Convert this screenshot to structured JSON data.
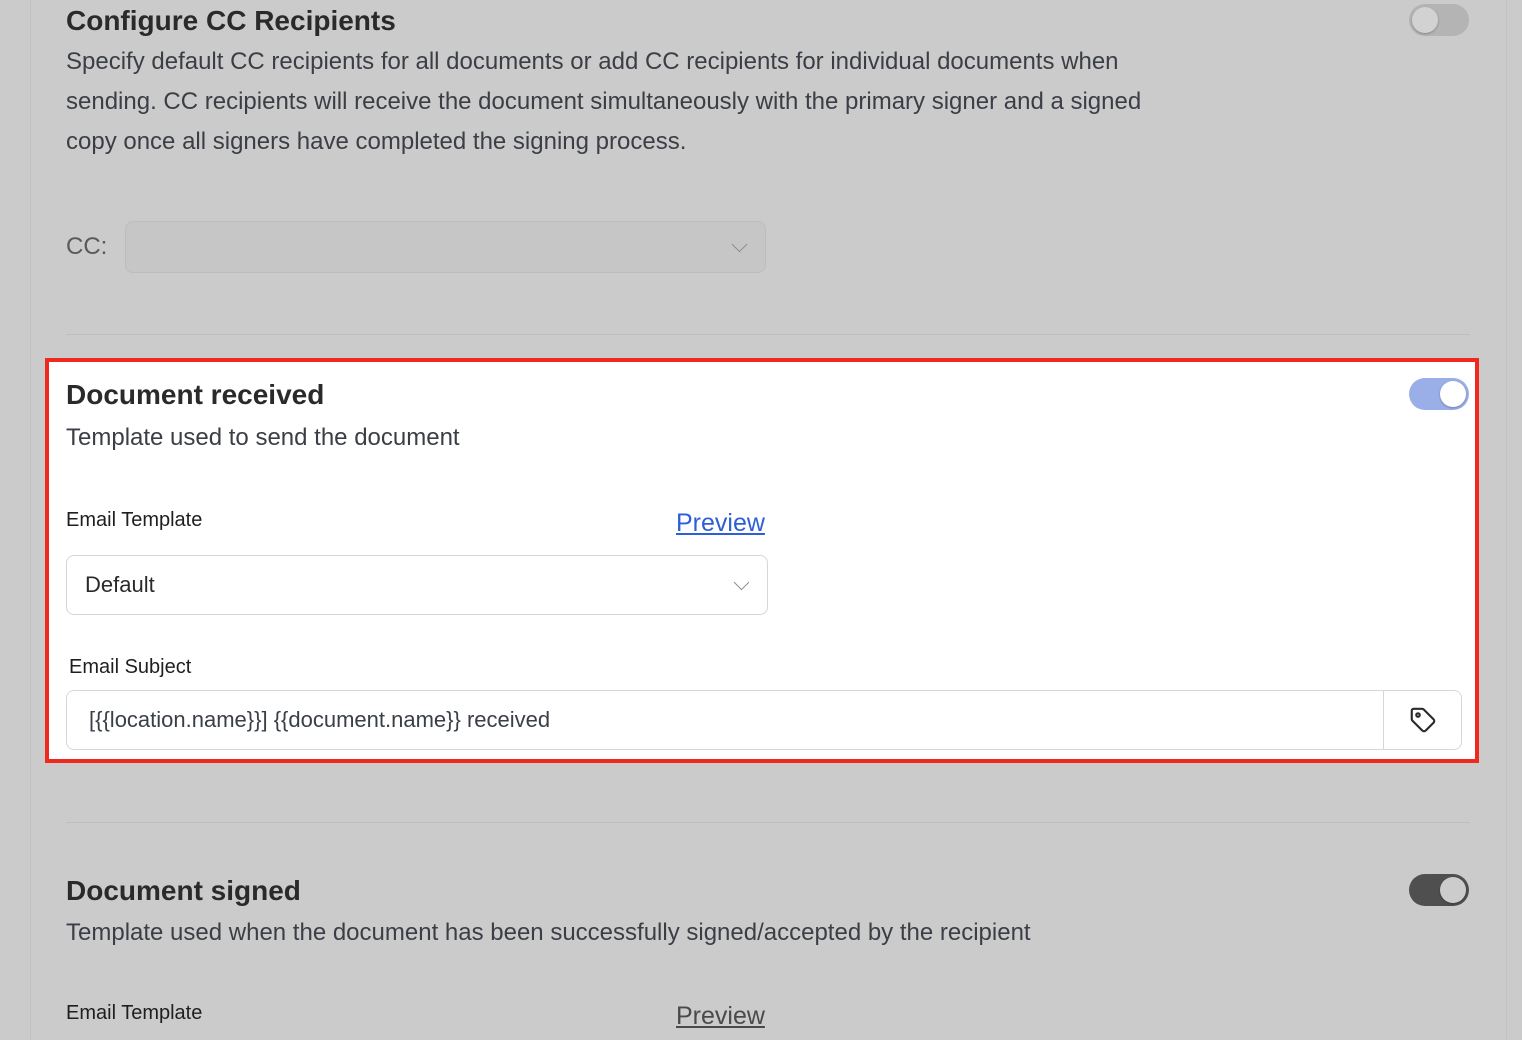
{
  "cc_section": {
    "title": "Configure CC Recipients",
    "description": "Specify default CC recipients for all documents or add CC recipients for individual documents when sending. CC recipients will receive the document simultaneously with the primary signer and a signed copy once all signers have completed the signing process.",
    "toggle_state": "off",
    "cc_label": "CC:",
    "cc_value": ""
  },
  "document_received": {
    "title": "Document received",
    "description": "Template used to send the document",
    "toggle_state": "on",
    "email_template_label": "Email Template",
    "preview_label": "Preview",
    "email_template_value": "Default",
    "email_subject_label": "Email Subject",
    "email_subject_value": "[{{location.name}}] {{document.name}} received",
    "highlight_color": "#f0291f"
  },
  "document_signed": {
    "title": "Document signed",
    "description": "Template used when the document has been successfully signed/accepted by the recipient",
    "toggle_state": "on",
    "email_template_label": "Email Template",
    "preview_label": "Preview"
  },
  "colors": {
    "link_blue": "#2e5fd8",
    "toggle_blue": "#9aaee8",
    "overlay_grey": "#cbcbcb"
  },
  "icons": {
    "tag": "tag-icon",
    "chevron": "chevron-down-icon"
  }
}
